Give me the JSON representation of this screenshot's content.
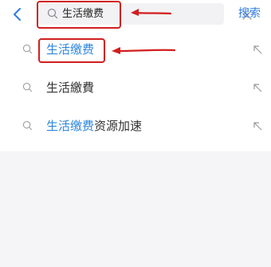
{
  "header": {
    "back_icon": "chevron-left-icon",
    "search_value": "生活缴费",
    "search_icon": "search-icon",
    "clear_icon": "close-icon",
    "search_button_label": "搜索"
  },
  "suggestions": [
    {
      "highlight": "生活缴费",
      "rest": "",
      "fill_icon": "arrow-up-left-icon"
    },
    {
      "highlight": "",
      "rest": "生活繳費",
      "fill_icon": "arrow-up-left-icon"
    },
    {
      "highlight": "生活缴费",
      "rest": "资源加速",
      "fill_icon": "arrow-up-left-icon"
    }
  ],
  "colors": {
    "accent": "#2f7be0",
    "highlight_text": "#2d86dc",
    "annotation": "#d21e1e"
  }
}
